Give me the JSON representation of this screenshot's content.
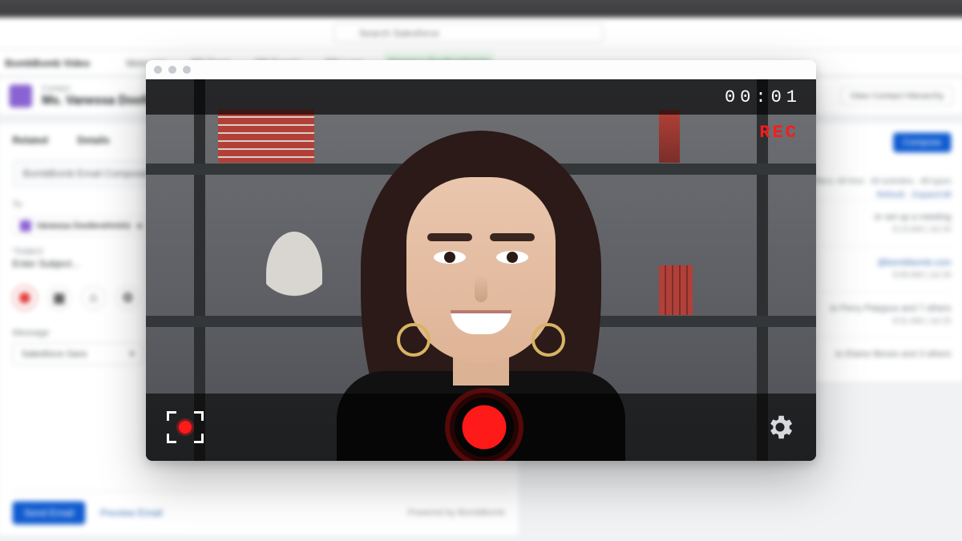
{
  "header": {
    "search_placeholder": "Search Salesforce"
  },
  "app": {
    "title": "BombBomb Video",
    "tabs": [
      "Welcome",
      "BB Team",
      "BB Events",
      "BB Logs"
    ],
    "active_tab": "Vanessa Doofenshmirtz"
  },
  "contact": {
    "label": "Contact",
    "name": "Ms. Vanessa Doofen…",
    "hierarchy_button": "View Contact Hierarchy"
  },
  "compose": {
    "tabs": {
      "related": "Related",
      "details": "Details"
    },
    "composer_title": "BombBomb Email Composer",
    "to_label": "To",
    "recipient_chip": "Vanessa Doofenshmirtz",
    "subject_label": "*Subject",
    "subject_value": "Enter Subject...",
    "message_label": "Message",
    "font_picker": "Salesforce Sans",
    "send_button": "Send Email",
    "preview_link": "Preview Email",
    "powered_by": "Powered by   BombBomb"
  },
  "activity": {
    "compose_button": "Compose",
    "filter_line": "Filters: All time · All activities · All types",
    "links": "Refresh · Expand All",
    "items": [
      {
        "text": "or set up a meeting",
        "time": "9:13 AM | Jul 26"
      },
      {
        "text": "@bombbomb.com",
        "time": "9:09 AM | Jul 26"
      },
      {
        "text": "to Perry Platypus and 7 others",
        "time": "8:51 AM | Jul 25"
      },
      {
        "text": "to Elaine Benes and 3 others",
        "time": ""
      }
    ]
  },
  "recorder": {
    "timer": "00:01",
    "rec_label": "REC"
  }
}
